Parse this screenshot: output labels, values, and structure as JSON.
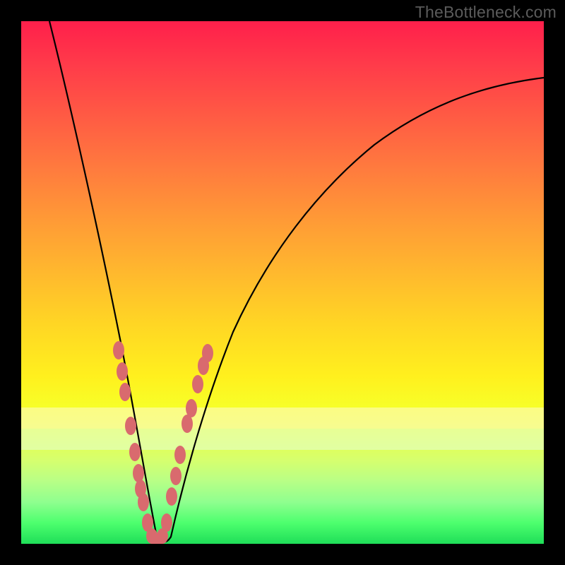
{
  "watermark": "TheBottleneck.com",
  "colors": {
    "gradient_top": "#ff1f4b",
    "gradient_bottom": "#1fde58",
    "curve": "#000000",
    "marker": "#d96a6e",
    "frame": "#000000"
  },
  "chart_data": {
    "type": "line",
    "title": "",
    "xlabel": "",
    "ylabel": "",
    "xlim": [
      0,
      100
    ],
    "ylim": [
      0,
      100
    ],
    "grid": false,
    "legend": false,
    "series": [
      {
        "name": "bottleneck-curve",
        "x": [
          0,
          3,
          6,
          9,
          12,
          15,
          18,
          20,
          22,
          23,
          24,
          25,
          26,
          27,
          28,
          30,
          33,
          37,
          42,
          48,
          55,
          63,
          72,
          82,
          92,
          100
        ],
        "y": [
          100,
          90,
          80,
          70,
          60,
          50,
          40,
          30,
          20,
          12,
          6,
          2,
          0,
          2,
          6,
          14,
          24,
          35,
          46,
          56,
          64,
          71,
          77,
          82,
          86,
          89
        ]
      }
    ],
    "markers": [
      {
        "x": 18.7,
        "y": 37.0
      },
      {
        "x": 19.3,
        "y": 33.0
      },
      {
        "x": 19.9,
        "y": 29.0
      },
      {
        "x": 21.0,
        "y": 22.5
      },
      {
        "x": 21.8,
        "y": 17.5
      },
      {
        "x": 22.4,
        "y": 13.5
      },
      {
        "x": 22.9,
        "y": 10.5
      },
      {
        "x": 23.4,
        "y": 8.0
      },
      {
        "x": 24.2,
        "y": 4.0
      },
      {
        "x": 25.0,
        "y": 1.5
      },
      {
        "x": 26.0,
        "y": 0.5
      },
      {
        "x": 27.0,
        "y": 1.5
      },
      {
        "x": 27.8,
        "y": 4.0
      },
      {
        "x": 28.8,
        "y": 9.0
      },
      {
        "x": 29.6,
        "y": 13.0
      },
      {
        "x": 30.4,
        "y": 17.0
      },
      {
        "x": 31.8,
        "y": 23.0
      },
      {
        "x": 32.5,
        "y": 26.0
      },
      {
        "x": 33.8,
        "y": 30.5
      },
      {
        "x": 34.8,
        "y": 34.0
      },
      {
        "x": 35.6,
        "y": 36.5
      }
    ],
    "bands": [
      {
        "name": "pale-yellow",
        "y_top": 26,
        "y_bottom": 22,
        "color": "#fffad0",
        "opacity": 0.55
      },
      {
        "name": "pale-green",
        "y_top": 22,
        "y_bottom": 18,
        "color": "#e4ffd9",
        "opacity": 0.55
      }
    ]
  }
}
